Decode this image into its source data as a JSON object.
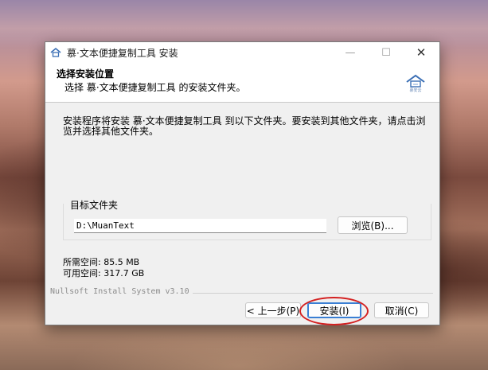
{
  "window": {
    "title": "慕·文本便捷复制工具 安装",
    "controls": {
      "minimize": "—",
      "maximize": "☐",
      "close": "✕"
    }
  },
  "header": {
    "title": "选择安装位置",
    "subtitle": "选择 慕·文本便捷复制工具 的安装文件夹。",
    "logo_text": "慕安云"
  },
  "body": {
    "description": "安装程序将安装 慕·文本便捷复制工具 到以下文件夹。要安装到其他文件夹，请点击浏览并选择其他文件夹。"
  },
  "destination": {
    "group_label": "目标文件夹",
    "path": "D:\\MuanText",
    "browse_label": "浏览(B)..."
  },
  "space": {
    "required": "所需空间: 85.5 MB",
    "available": "可用空间: 317.7 GB"
  },
  "footer": {
    "brand": "Nullsoft Install System v3.10",
    "back_label": "< 上一步(P)",
    "install_label": "安装(I)",
    "cancel_label": "取消(C)"
  },
  "colors": {
    "accent": "#3a7fd4",
    "annotation": "#d42020"
  }
}
